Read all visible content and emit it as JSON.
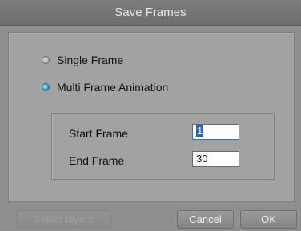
{
  "dialog": {
    "title": "Save Frames"
  },
  "options": {
    "single_frame_label": "Single Frame",
    "single_frame_selected": false,
    "multi_frame_label": "Multi Frame Animation",
    "multi_frame_selected": true
  },
  "range": {
    "start_label": "Start Frame",
    "start_value": "1",
    "end_label": "End Frame",
    "end_value": "30"
  },
  "buttons": {
    "select_layers_label": "Select layers",
    "cancel_label": "Cancel",
    "ok_label": "OK"
  },
  "colors": {
    "radio_selected": "#2c98c4",
    "text_selection": "#2f63b0"
  }
}
